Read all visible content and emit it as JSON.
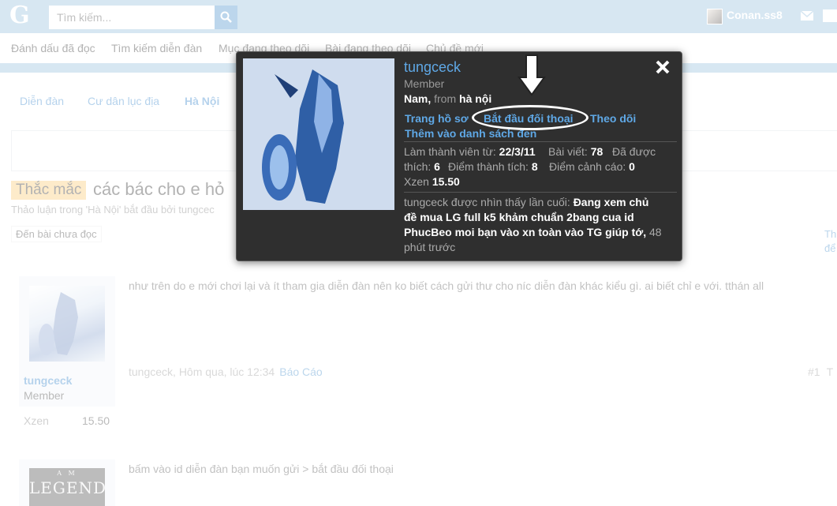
{
  "header": {
    "logo": "G",
    "search_placeholder": "Tìm kiếm...",
    "username": "Conan.ss8"
  },
  "subnav": {
    "items": [
      "Đánh dấu đã đọc",
      "Tìm kiếm diễn đàn",
      "Mục đang theo dõi",
      "Bài đang theo dõi",
      "Chủ đề mới"
    ]
  },
  "breadcrumb": [
    "Diễn đàn",
    "Cư dân lục địa",
    "Hà Nội"
  ],
  "thread": {
    "prefix": "Thắc mắc",
    "title": "các bác cho e hỏ",
    "meta": "Thảo luận trong 'Hà Nội' bắt đầu bởi tungcec",
    "unread_button": "Đến bài chưa đọc",
    "right_edge": [
      "Th",
      "để"
    ]
  },
  "posts": [
    {
      "user": "tungceck",
      "role": "Member",
      "stat_label": "Xzen",
      "stat_value": "15.50",
      "text": "như trên do e mới chơi lại và ít tham gia diễn đàn nên ko biết cách gửi thư cho níc diễn đàn khác kiểu gì. ai biết chỉ e với. tthán all",
      "author_time": "tungceck, Hôm qua, lúc 12:34",
      "report": "Báo Cáo",
      "number": "#1",
      "number_extra": "T"
    },
    {
      "avatar_text": "LEGEND",
      "avatar_small": "A M",
      "text": "bấm vào id diễn đàn bạn muốn gửi > bắt đầu đối thoại"
    }
  ],
  "card": {
    "name": "tungceck",
    "role": "Member",
    "gender": "Nam,",
    "from_label": "from",
    "location": "hà nội",
    "links": {
      "profile": "Trang hồ sơ",
      "start_conversation": "Bắt đầu đối thoại",
      "follow": "Theo dõi",
      "ignore": "Thêm vào danh sách đen"
    },
    "stats": {
      "joined_label": "Làm thành viên từ:",
      "joined_value": "22/3/11",
      "posts_label": "Bài viết:",
      "posts_value": "78",
      "likes_label_1": "Đã được",
      "likes_label_2": "thích:",
      "likes_value": "6",
      "points_label": "Điểm thành tích:",
      "points_value": "8",
      "warn_label": "Điểm cảnh cáo:",
      "warn_value": "0",
      "xzen_label": "Xzen",
      "xzen_value": "15.50"
    },
    "last_seen": {
      "label": "tungceck được nhìn thấy lần cuối:",
      "activity_1": "Đang xem chủ",
      "activity_2": "đề mua LG full k5 khảm chuẩn 2bang cua id",
      "activity_3": "PhucBeo moi bạn vào xn toàn vào TG giúp tớ,",
      "ago_1": "48",
      "ago_2": "phút trước"
    }
  },
  "colors": {
    "topbar": "#a6c9e2",
    "link": "#5b9bd5",
    "card_bg": "#2f2f2f",
    "prefix_bg": "#fbd38b"
  }
}
